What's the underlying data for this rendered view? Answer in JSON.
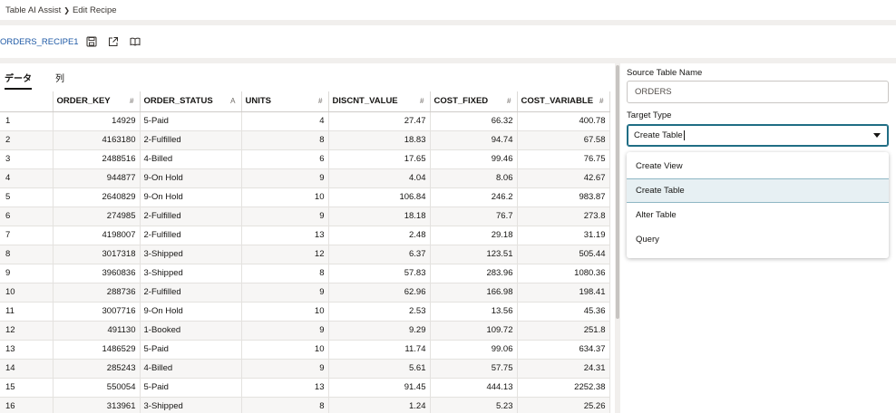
{
  "breadcrumb": {
    "parent": "Table AI Assist",
    "current": "Edit Recipe"
  },
  "recipe": {
    "name": "ORDERS_RECIPE1",
    "icons": [
      "save-icon",
      "export-icon",
      "book-icon"
    ]
  },
  "tabs": [
    {
      "label": "データ",
      "active": true
    },
    {
      "label": "列",
      "active": false
    }
  ],
  "grid": {
    "columns": [
      {
        "label": "",
        "type_symbol": ""
      },
      {
        "label": "ORDER_KEY",
        "type_symbol": "#"
      },
      {
        "label": "ORDER_STATUS",
        "type_symbol": "A"
      },
      {
        "label": "UNITS",
        "type_symbol": "#"
      },
      {
        "label": "DISCNT_VALUE",
        "type_symbol": "#"
      },
      {
        "label": "COST_FIXED",
        "type_symbol": "#"
      },
      {
        "label": "COST_VARIABLE",
        "type_symbol": "#"
      }
    ],
    "rows": [
      [
        "1",
        "14929",
        "5-Paid",
        "4",
        "27.47",
        "66.32",
        "400.78"
      ],
      [
        "2",
        "4163180",
        "2-Fulfilled",
        "8",
        "18.83",
        "94.74",
        "67.58"
      ],
      [
        "3",
        "2488516",
        "4-Billed",
        "6",
        "17.65",
        "99.46",
        "76.75"
      ],
      [
        "4",
        "944877",
        "9-On Hold",
        "9",
        "4.04",
        "8.06",
        "42.67"
      ],
      [
        "5",
        "2640829",
        "9-On Hold",
        "10",
        "106.84",
        "246.2",
        "983.87"
      ],
      [
        "6",
        "274985",
        "2-Fulfilled",
        "9",
        "18.18",
        "76.7",
        "273.8"
      ],
      [
        "7",
        "4198007",
        "2-Fulfilled",
        "13",
        "2.48",
        "29.18",
        "31.19"
      ],
      [
        "8",
        "3017318",
        "3-Shipped",
        "12",
        "6.37",
        "123.51",
        "505.44"
      ],
      [
        "9",
        "3960836",
        "3-Shipped",
        "8",
        "57.83",
        "283.96",
        "1080.36"
      ],
      [
        "10",
        "288736",
        "2-Fulfilled",
        "9",
        "62.96",
        "166.98",
        "198.41"
      ],
      [
        "11",
        "3007716",
        "9-On Hold",
        "10",
        "2.53",
        "13.56",
        "45.36"
      ],
      [
        "12",
        "491130",
        "1-Booked",
        "9",
        "9.29",
        "109.72",
        "251.8"
      ],
      [
        "13",
        "1486529",
        "5-Paid",
        "10",
        "11.74",
        "99.06",
        "634.37"
      ],
      [
        "14",
        "285243",
        "4-Billed",
        "9",
        "5.61",
        "57.75",
        "24.31"
      ],
      [
        "15",
        "550054",
        "5-Paid",
        "13",
        "91.45",
        "444.13",
        "2252.38"
      ],
      [
        "16",
        "313961",
        "3-Shipped",
        "8",
        "1.24",
        "5.23",
        "25.26"
      ]
    ]
  },
  "form": {
    "source_label": "Source Table Name",
    "source_value": "ORDERS",
    "target_label": "Target Type",
    "target_value": "Create Table",
    "options": [
      "Create View",
      "Create Table",
      "Alter Table",
      "Query"
    ],
    "selected_option": "Create Table"
  }
}
